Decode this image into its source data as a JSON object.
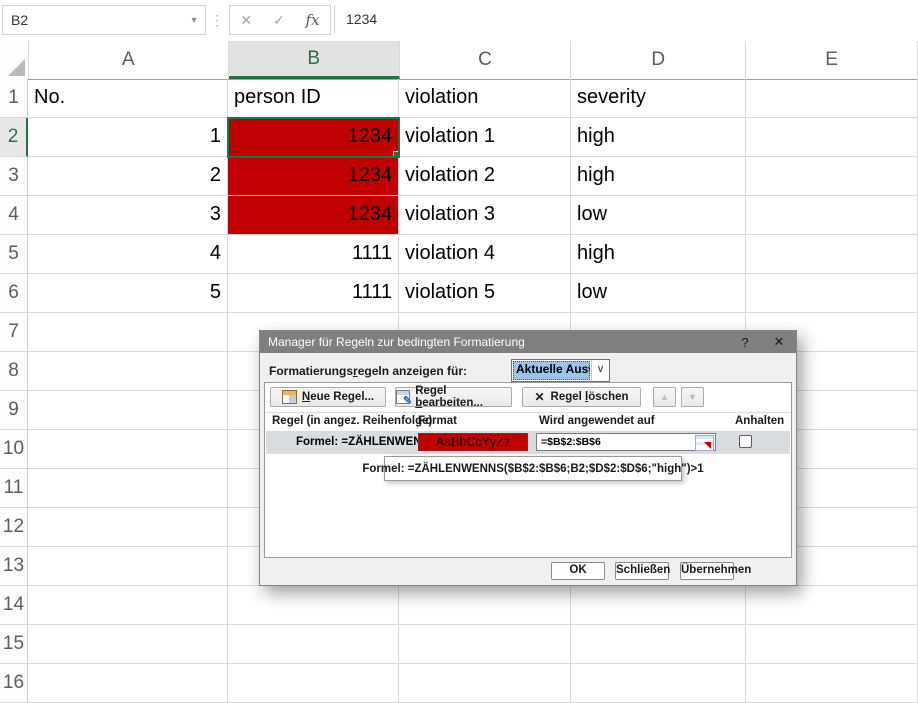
{
  "colors": {
    "excel_green": "#217346",
    "conditional_red": "#c00000",
    "dialog_titlebar": "#7f7f7f",
    "combo_selection": "#9cc3ec",
    "rule_row_bg": "#d9dde2"
  },
  "formula_bar": {
    "name_box_value": "B2",
    "formula_value": "1234",
    "icons": {
      "name_dropdown": "▾",
      "vertical_dots": "⋮",
      "cancel": "✕",
      "enter": "✓",
      "fx": "fx"
    }
  },
  "sheet": {
    "columns": [
      "A",
      "B",
      "C",
      "D",
      "E"
    ],
    "rows": [
      {
        "num": "1",
        "a": "No.",
        "b": "person ID",
        "c": "violation",
        "d": "severity"
      },
      {
        "num": "2",
        "a": "1",
        "b": "1234",
        "c": "violation 1",
        "d": "high"
      },
      {
        "num": "3",
        "a": "2",
        "b": "1234",
        "c": "violation 2",
        "d": "high"
      },
      {
        "num": "4",
        "a": "3",
        "b": "1234",
        "c": "violation 3",
        "d": "low"
      },
      {
        "num": "5",
        "a": "4",
        "b": "1111",
        "c": "violation 4",
        "d": "high"
      },
      {
        "num": "6",
        "a": "5",
        "b": "1111",
        "c": "violation 5",
        "d": "low"
      },
      {
        "num": "7"
      },
      {
        "num": "8"
      },
      {
        "num": "9"
      },
      {
        "num": "10"
      },
      {
        "num": "11"
      },
      {
        "num": "12"
      },
      {
        "num": "13"
      },
      {
        "num": "14"
      },
      {
        "num": "15"
      },
      {
        "num": "16"
      }
    ]
  },
  "dialog": {
    "title": "Manager für Regeln zur bedingten Formatierung",
    "help_glyph": "?",
    "close_glyph": "✕",
    "show_rules_label": {
      "pre": "Formatierungs",
      "key": "r",
      "post": "egeln anzeigen für:"
    },
    "scope_value": "Aktuelle Auswahl",
    "combo_chevron": "∨",
    "buttons": {
      "new_rule": {
        "pre": "",
        "key": "N",
        "post": "eue Regel..."
      },
      "edit_rule": {
        "pre": "Regel ",
        "key": "b",
        "post": "earbeiten..."
      },
      "delete_rule": {
        "pre": "Regel ",
        "key": "l",
        "post": "öschen"
      },
      "delete_x_glyph": "✕",
      "move_up_glyph": "▲",
      "move_down_glyph": "▼",
      "edit_pencil_glyph": "✎"
    },
    "table_headers": [
      "Regel (in angez. Reihenfolge)",
      "Format",
      "Wird angewendet auf",
      "Anhalten"
    ],
    "rule": {
      "name": "Formel: =ZÄHLENWENN...",
      "format_preview": "AaBbCcYyZz",
      "applies_to": "=$B$2:$B$6",
      "stop_if_true_checked": false
    },
    "tooltip": "Formel: =ZÄHLENWENNS($B$2:$B$6;B2;$D$2:$D$6;\"high\")>1",
    "footer": {
      "ok": "OK",
      "close": "Schließen",
      "apply": "Übernehmen"
    }
  }
}
